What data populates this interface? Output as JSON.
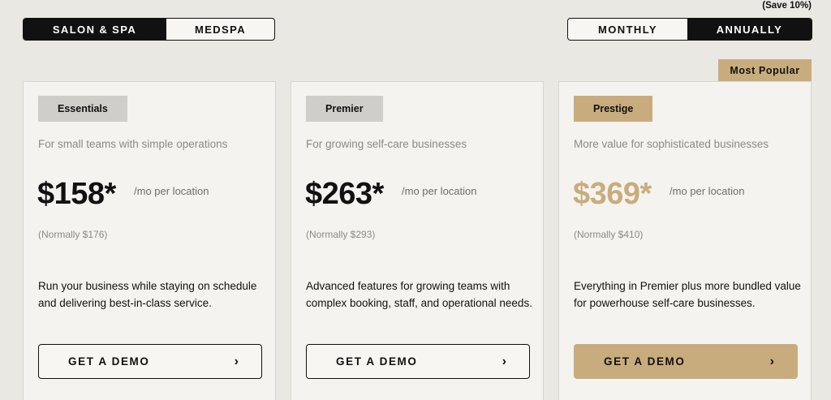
{
  "segment_toggle": {
    "options": [
      "SALON & SPA",
      "MEDSPA"
    ],
    "active": "SALON & SPA"
  },
  "billing_toggle": {
    "options": [
      "MONTHLY",
      "ANNUALLY"
    ],
    "active": "ANNUALLY",
    "save_note": "(Save 10%)"
  },
  "popular_badge": "Most Popular",
  "per_unit": "/mo per location",
  "cta_label": "GET A DEMO",
  "cta_chevron": "›",
  "plans": [
    {
      "name": "Essentials",
      "tagline": "For small teams with simple operations",
      "price": "$158*",
      "normally": "(Normally $176)",
      "description": "Run your business while staying on schedule and delivering best-in-class service."
    },
    {
      "name": "Premier",
      "tagline": "For growing self-care businesses",
      "price": "$263*",
      "normally": "(Normally $293)",
      "description": "Advanced features for growing teams with complex booking, staff, and operational needs."
    },
    {
      "name": "Prestige",
      "tagline": "More value for sophisticated businesses",
      "price": "$369*",
      "normally": "(Normally $410)",
      "description": "Everything in Premier plus more bundled value for powerhouse self-care businesses."
    }
  ],
  "colors": {
    "accent_gold": "#c9ac7e",
    "dark": "#111111",
    "background": "#e9e8e3",
    "card": "#f4f3ef"
  }
}
